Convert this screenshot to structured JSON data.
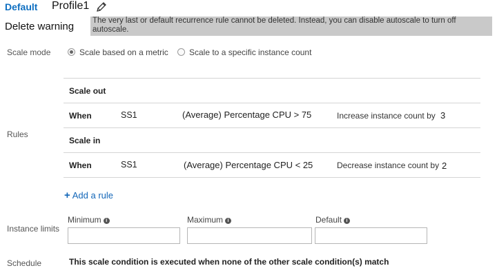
{
  "header": {
    "tab_label": "Default",
    "profile_name": "Profile1"
  },
  "warning": {
    "label": "Delete warning",
    "message": "The very last or default recurrence rule cannot be deleted. Instead, you can disable autoscale to turn off autoscale."
  },
  "scale_mode": {
    "label": "Scale mode",
    "options": [
      {
        "label": "Scale based on a metric",
        "selected": true
      },
      {
        "label": "Scale to a specific instance count",
        "selected": false
      }
    ]
  },
  "rules": {
    "label": "Rules",
    "scale_out": {
      "heading": "Scale out",
      "when": "When",
      "resource": "SS1",
      "condition": "(Average) Percentage CPU > 75",
      "action": "Increase instance count by",
      "count": "3"
    },
    "scale_in": {
      "heading": "Scale in",
      "when": "When",
      "resource": "SS1",
      "condition": "(Average) Percentage CPU < 25",
      "action": "Decrease instance count by",
      "count": "2"
    },
    "add_rule_label": "Add a rule"
  },
  "instance_limits": {
    "label": "Instance limits",
    "minimum": {
      "label": "Minimum",
      "value": ""
    },
    "maximum": {
      "label": "Maximum",
      "value": ""
    },
    "default": {
      "label": "Default",
      "value": ""
    }
  },
  "schedule": {
    "label": "Schedule",
    "text": "This scale condition is executed when none of the other scale condition(s) match"
  },
  "colors": {
    "accent": "#0e6fc1",
    "warning_bg": "#c9c9c9"
  }
}
